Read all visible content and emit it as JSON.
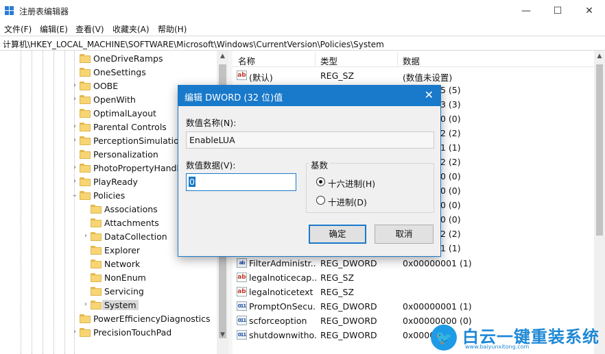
{
  "window": {
    "title": "注册表编辑器",
    "minimize": "—",
    "maximize": "☐",
    "close": "✕"
  },
  "menu": [
    "文件(F)",
    "编辑(E)",
    "查看(V)",
    "收藏夹(A)",
    "帮助(H)"
  ],
  "address": "计算机\\HKEY_LOCAL_MACHINE\\SOFTWARE\\Microsoft\\Windows\\CurrentVersion\\Policies\\System",
  "tree": [
    {
      "label": "OneDriveRamps",
      "expander": ""
    },
    {
      "label": "OneSettings",
      "expander": ""
    },
    {
      "label": "OOBE",
      "expander": "›"
    },
    {
      "label": "OpenWith",
      "expander": "›"
    },
    {
      "label": "OptimalLayout",
      "expander": ""
    },
    {
      "label": "Parental Controls",
      "expander": "›"
    },
    {
      "label": "PerceptionSimulation",
      "expander": "›"
    },
    {
      "label": "Personalization",
      "expander": ""
    },
    {
      "label": "PhotoPropertyHandle",
      "expander": "›"
    },
    {
      "label": "PlayReady",
      "expander": "›"
    },
    {
      "label": "Policies",
      "expander": "⌄"
    },
    {
      "label": "Associations",
      "expander": ""
    },
    {
      "label": "Attachments",
      "expander": ""
    },
    {
      "label": "DataCollection",
      "expander": "›"
    },
    {
      "label": "Explorer",
      "expander": ""
    },
    {
      "label": "Network",
      "expander": ""
    },
    {
      "label": "NonEnum",
      "expander": ""
    },
    {
      "label": "Servicing",
      "expander": ""
    },
    {
      "label": "System",
      "expander": "›"
    },
    {
      "label": "PowerEfficiencyDiagnostics",
      "expander": ""
    },
    {
      "label": "PrecisionTouchPad",
      "expander": "›"
    }
  ],
  "list": {
    "headers": [
      "名称",
      "类型",
      "数据"
    ],
    "rows": [
      {
        "icon": "ab",
        "name": "(默认)",
        "type": "REG_SZ",
        "data": "(数值未设置)"
      },
      {
        "icon": "ab",
        "name": "FilterAdministr...",
        "type": "REG_DWORD",
        "data": "0x00000001 (1)"
      },
      {
        "icon": "ab",
        "name": "legalnoticecap...",
        "type": "REG_SZ",
        "data": ""
      },
      {
        "icon": "ab",
        "name": "legalnoticetext",
        "type": "REG_SZ",
        "data": ""
      },
      {
        "icon": "011",
        "name": "PromptOnSecu...",
        "type": "REG_DWORD",
        "data": "0x00000001 (1)"
      },
      {
        "icon": "011",
        "name": "scforceoption",
        "type": "REG_DWORD",
        "data": "0x00000000 (0)"
      },
      {
        "icon": "011",
        "name": "shutdownwitho...",
        "type": "REG_DWORD",
        "data": "0x0000"
      }
    ],
    "partial_data": [
      "05 (5)",
      "03 (3)",
      "00 (0)",
      "02 (2)",
      "01 (1)",
      "02 (2)",
      "00 (0)",
      "00 (0)",
      "00 (0)",
      "00 (0)",
      "02 (2)",
      "01 (1)"
    ]
  },
  "dialog": {
    "title": "编辑 DWORD (32 位)值",
    "close": "✕",
    "name_label": "数值名称(N):",
    "name_value": "EnableLUA",
    "data_label": "数值数据(V):",
    "data_value": "0",
    "base_label": "基数",
    "hex_label": "十六进制(H)",
    "dec_label": "十进制(D)",
    "selected_base": "hex",
    "ok": "确定",
    "cancel": "取消"
  },
  "watermark": {
    "title": "白云一键重装系统",
    "url": "www.baiyunxitong.com"
  },
  "colors": {
    "accent": "#1979ca",
    "folder": "#f7d574"
  }
}
